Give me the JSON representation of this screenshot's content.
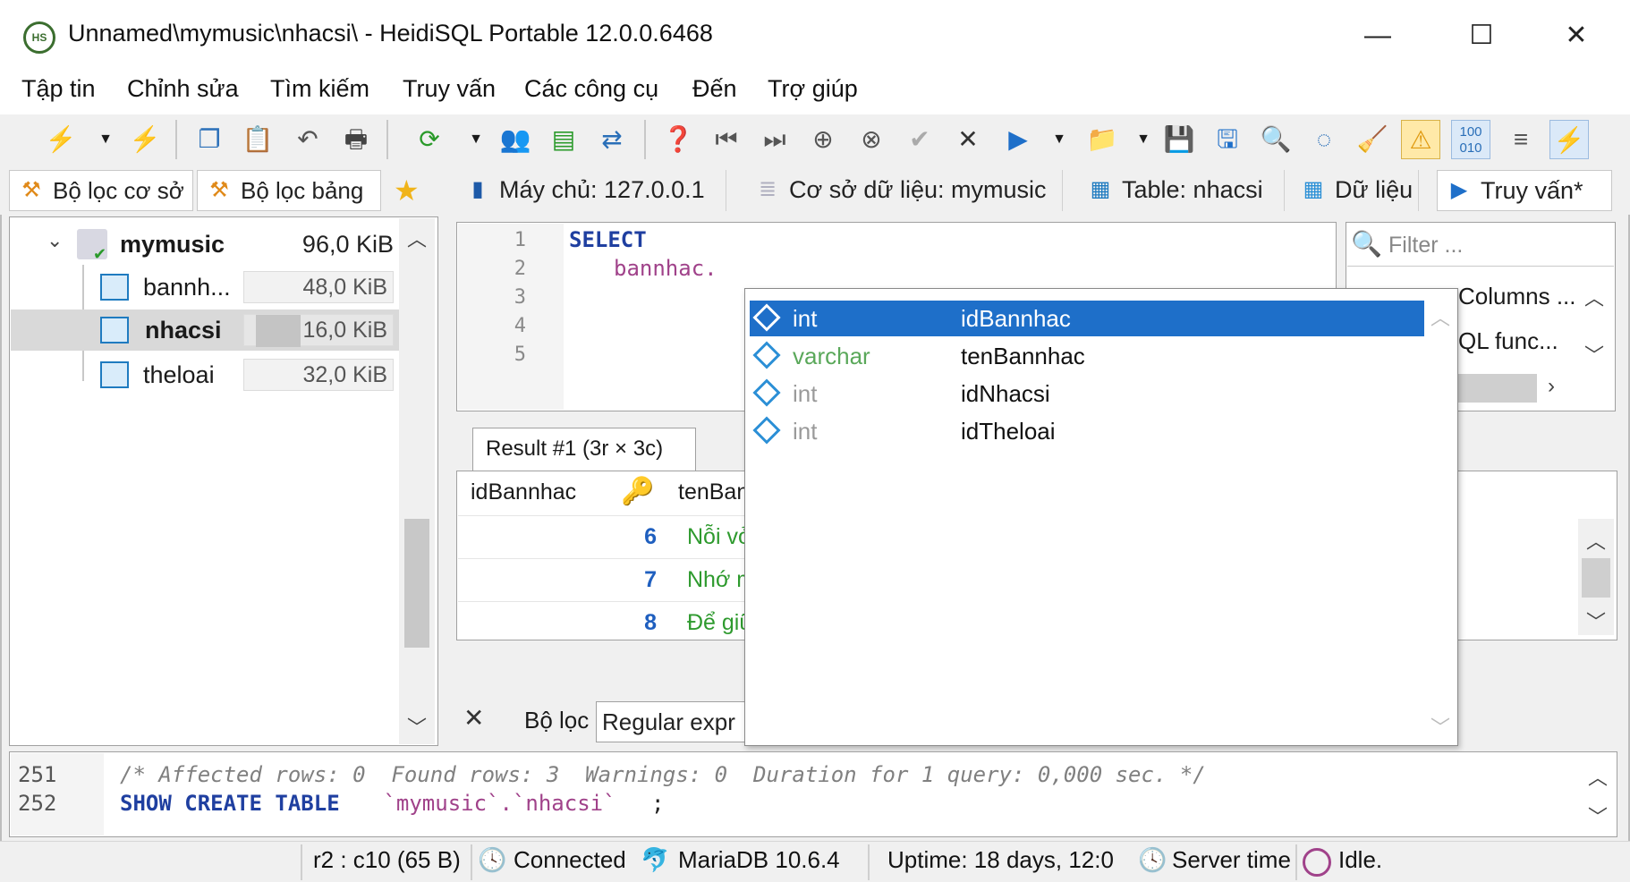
{
  "window": {
    "title": "Unnamed\\mymusic\\nhacsi\\ - HeidiSQL Portable 12.0.0.6468",
    "minimize": "—",
    "maximize": "☐",
    "close": "✕",
    "logo": "HS"
  },
  "menu": [
    "Tập tin",
    "Chỉnh sửa",
    "Tìm kiếm",
    "Truy vấn",
    "Các công cụ",
    "Đến",
    "Trợ giúp"
  ],
  "filters": {
    "db_filter": "Bộ lọc cơ sở",
    "table_filter": "Bộ lọc bảng"
  },
  "tabs": [
    {
      "label": "Máy chủ: 127.0.0.1",
      "icon": "server-icon"
    },
    {
      "label": "Cơ sở dữ liệu: mymusic",
      "icon": "database-icon"
    },
    {
      "label": "Table: nhacsi",
      "icon": "table-icon"
    },
    {
      "label": "Dữ liệu",
      "icon": "grid-icon"
    },
    {
      "label": "Truy vấn*",
      "icon": "play-icon"
    }
  ],
  "tree": {
    "database": {
      "name": "mymusic",
      "size": "96,0 KiB"
    },
    "tables": [
      {
        "name": "bannh...",
        "size": "48,0 KiB"
      },
      {
        "name": "nhacsi",
        "size": "16,0 KiB"
      },
      {
        "name": "theloai",
        "size": "32,0 KiB"
      }
    ]
  },
  "editor": {
    "line_numbers": [
      "1",
      "2",
      "3",
      "4",
      "5"
    ],
    "line1": "SELECT",
    "line2": "bannhac."
  },
  "right_panel": {
    "filter_placeholder": "Filter ...",
    "items": [
      "Columns ...",
      "QL func..."
    ]
  },
  "result": {
    "tab_label": "Result #1 (3r × 3c)",
    "columns": [
      "idBannhac",
      "tenBan"
    ],
    "rows": [
      {
        "id": "6",
        "name": "Nỗi vở"
      },
      {
        "id": "7",
        "name": "Nhớ m"
      },
      {
        "id": "8",
        "name": "Để giữ"
      }
    ]
  },
  "filter": {
    "close": "✕",
    "label": "Bộ lọc",
    "placeholder": "Regular expr"
  },
  "autocomplete": [
    {
      "type": "int",
      "name": "idBannhac",
      "type_color": "#ffffff"
    },
    {
      "type": "varchar",
      "name": "tenBannhac",
      "type_color": "#5aa85a"
    },
    {
      "type": "int",
      "name": "idNhacsi",
      "type_color": "#9a9a9a"
    },
    {
      "type": "int",
      "name": "idTheloai",
      "type_color": "#9a9a9a"
    }
  ],
  "log": {
    "lines": [
      {
        "no": "251",
        "text": "/* Affected rows: 0  Found rows: 3  Warnings: 0  Duration for 1 query: 0,000 sec. */"
      },
      {
        "no": "252",
        "text_kw1": "SHOW CREATE TABLE",
        "text_str": " `mymusic`.`nhacsi`",
        "text_end": ";"
      }
    ]
  },
  "status": {
    "position": "r2 : c10 (65 B)",
    "connected": "Connected",
    "server": "MariaDB 10.6.4",
    "uptime": "Uptime: 18 days, 12:0",
    "server_time": "Server time",
    "idle": "Idle."
  },
  "colors": {
    "selection": "#1e6fc9",
    "keyword": "#1f3fa0",
    "string": "#a0428a",
    "number": "#1f5fbf",
    "green_text": "#2e9a2e"
  }
}
